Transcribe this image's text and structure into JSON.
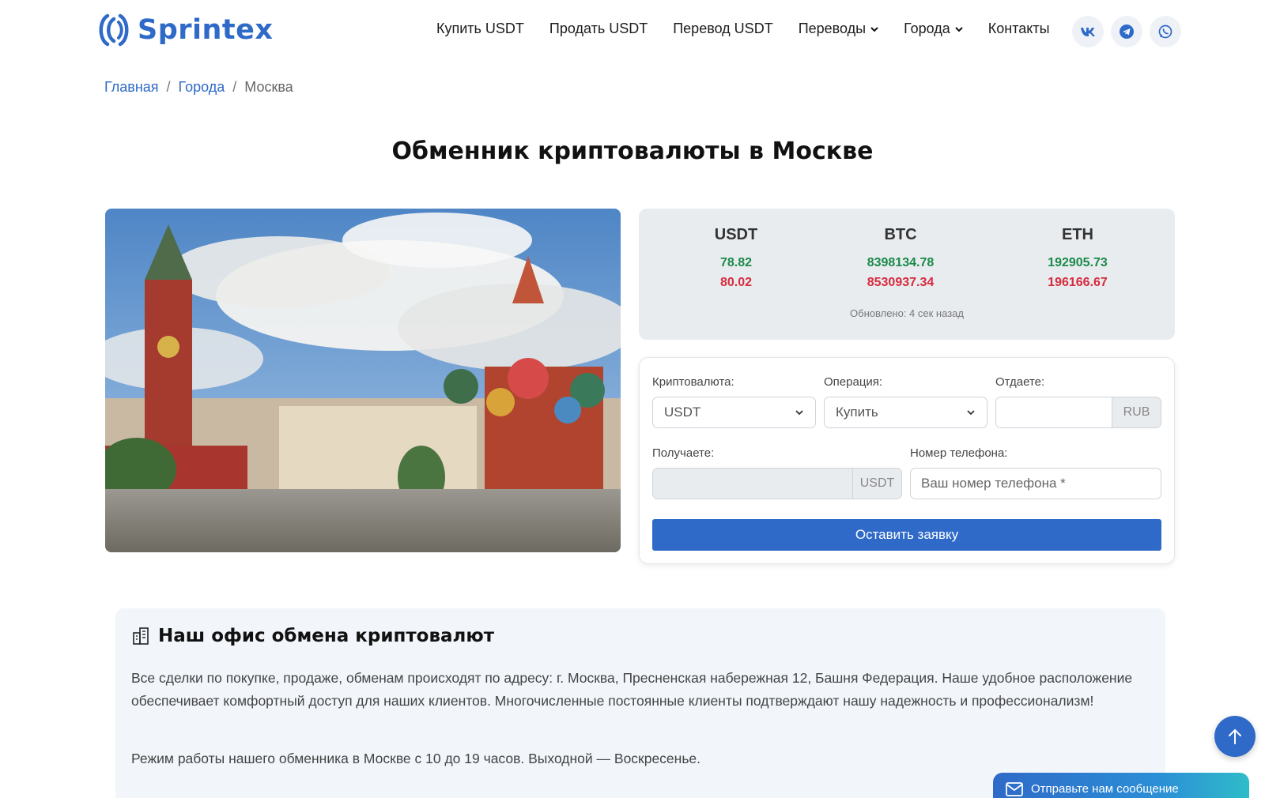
{
  "brand": {
    "name": "Sprintex"
  },
  "nav": {
    "items": [
      {
        "label": "Купить USDT",
        "dropdown": false
      },
      {
        "label": "Продать USDT",
        "dropdown": false
      },
      {
        "label": "Перевод USDT",
        "dropdown": false
      },
      {
        "label": "Переводы",
        "dropdown": true
      },
      {
        "label": "Города",
        "dropdown": true
      },
      {
        "label": "Контакты",
        "dropdown": false
      }
    ],
    "socials": [
      "vk-icon",
      "telegram-icon",
      "whatsapp-icon"
    ]
  },
  "breadcrumb": {
    "home": "Главная",
    "cities": "Города",
    "current": "Москва",
    "separator": "/"
  },
  "page": {
    "title": "Обменник криптовалюты в Москве"
  },
  "rates": {
    "items": [
      {
        "name": "USDT",
        "buy": "78.82",
        "sell": "80.02"
      },
      {
        "name": "BTC",
        "buy": "8398134.78",
        "sell": "8530937.34"
      },
      {
        "name": "ETH",
        "buy": "192905.73",
        "sell": "196166.67"
      }
    ],
    "updated": "Обновлено: 4 сек назад"
  },
  "form": {
    "crypto_label": "Криптовалюта:",
    "crypto_value": "USDT",
    "operation_label": "Операция:",
    "operation_value": "Купить",
    "give_label": "Отдаете:",
    "give_currency": "RUB",
    "receive_label": "Получаете:",
    "receive_currency": "USDT",
    "phone_label": "Номер телефона:",
    "phone_placeholder": "Ваш номер телефона *",
    "submit_label": "Оставить заявку"
  },
  "office": {
    "title": "Наш офис обмена криптовалют",
    "paragraph1": "Все сделки по покупке, продаже, обменам происходят по адресу: г. Москва, Пресненская набережная 12, Башня Федерация. Наше удобное расположение обеспечивает комфортный доступ для наших клиентов. Многочисленные постоянные клиенты подтверждают нашу надежность и профессионализм!",
    "paragraph2": "Режим работы нашего обменника в Москве с 10 до 19 часов. Выходной — Воскресенье."
  },
  "chat": {
    "label": "Отправьте нам сообщение"
  },
  "colors": {
    "accent": "#2f6ac8",
    "buy": "#1a8a4a",
    "sell": "#d62b3f"
  }
}
